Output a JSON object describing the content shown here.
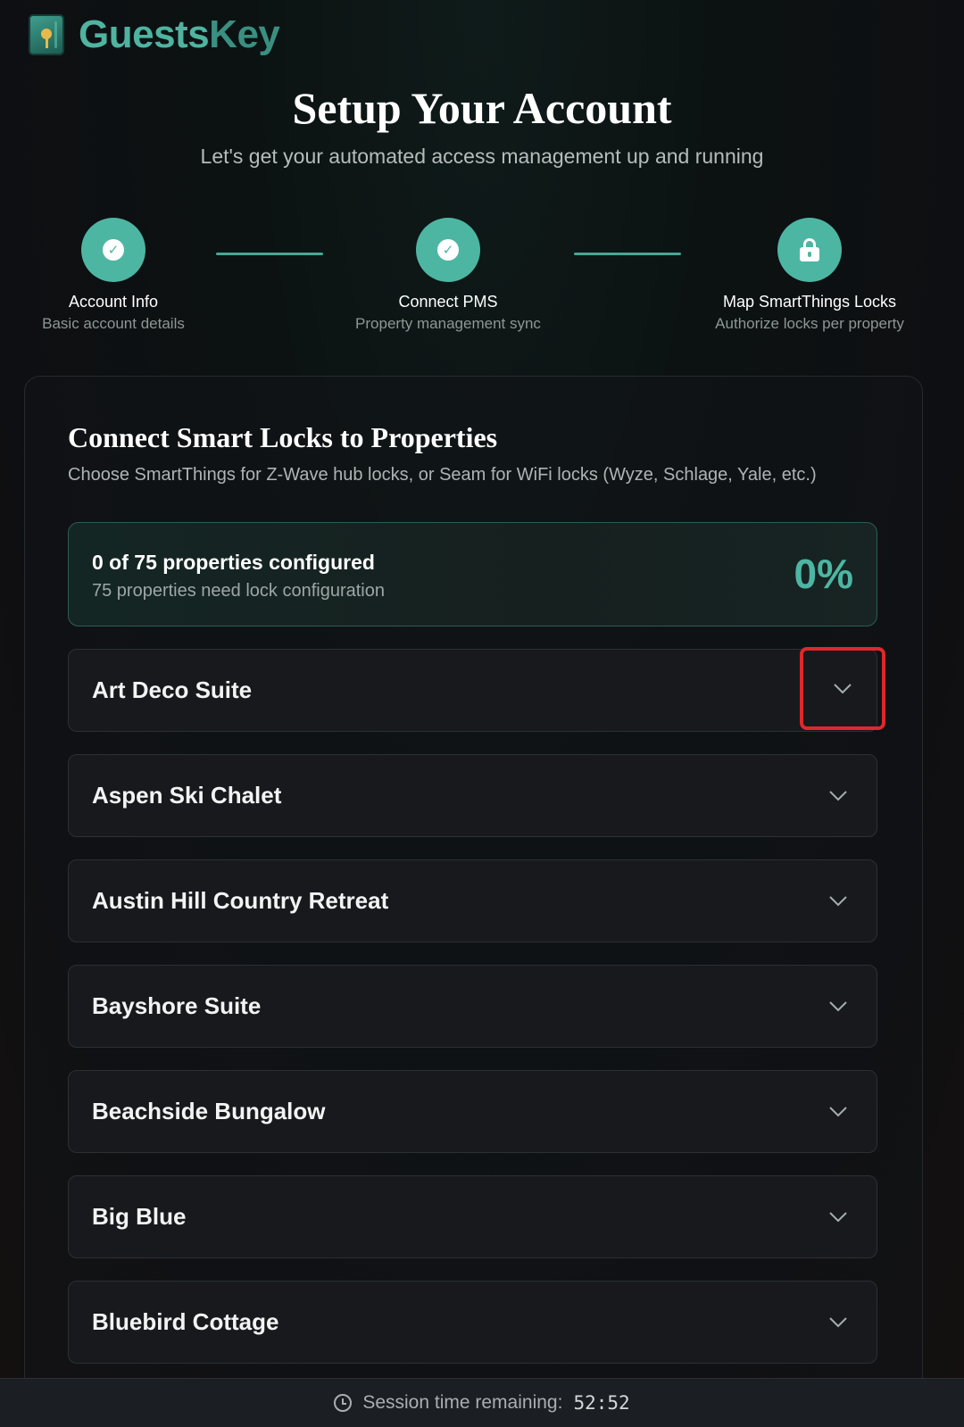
{
  "brand": {
    "name_part1": "Guests",
    "name_part2": "Key",
    "icon": "key-door-logo-icon"
  },
  "header": {
    "title": "Setup Your Account",
    "subtitle": "Let's get your automated access management up and running"
  },
  "steps": [
    {
      "label": "Account Info",
      "desc": "Basic account details",
      "icon": "check-icon",
      "status": "complete"
    },
    {
      "label": "Connect PMS",
      "desc": "Property management sync",
      "icon": "check-icon",
      "status": "complete"
    },
    {
      "label": "Map SmartThings Locks",
      "desc": "Authorize locks per property",
      "icon": "lock-icon",
      "status": "current"
    }
  ],
  "card": {
    "title": "Connect Smart Locks to Properties",
    "description": "Choose SmartThings for Z-Wave hub locks, or Seam for WiFi locks (Wyze, Schlage, Yale, etc.)"
  },
  "progress": {
    "title": "0 of 75 properties configured",
    "subtitle": "75 properties need lock configuration",
    "percent_label": "0%",
    "configured": 0,
    "total": 75
  },
  "properties": [
    {
      "name": "Art Deco Suite"
    },
    {
      "name": "Aspen Ski Chalet"
    },
    {
      "name": "Austin Hill Country Retreat"
    },
    {
      "name": "Bayshore Suite"
    },
    {
      "name": "Beachside Bungalow"
    },
    {
      "name": "Big Blue"
    },
    {
      "name": "Bluebird Cottage"
    }
  ],
  "footer": {
    "label": "Session time remaining:",
    "timer": "52:52",
    "icon": "clock-icon"
  },
  "colors": {
    "accent": "#4db6a3",
    "highlight": "#e0282a",
    "background": "#0e1112"
  }
}
